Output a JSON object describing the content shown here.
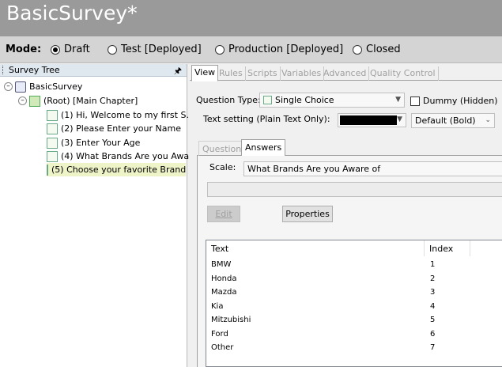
{
  "window": {
    "title": "BasicSurvey*"
  },
  "mode": {
    "label": "Mode:",
    "options": [
      {
        "label": "Draft",
        "selected": true
      },
      {
        "label": "Test [Deployed]",
        "selected": false
      },
      {
        "label": "Production [Deployed]",
        "selected": false
      },
      {
        "label": "Closed",
        "selected": false
      }
    ]
  },
  "survey_tree": {
    "title": "Survey Tree",
    "pin_icon": "pin-icon",
    "nodes": [
      {
        "label": "BasicSurvey"
      },
      {
        "label": "(Root) [Main Chapter]"
      },
      {
        "label": "(1) Hi,  Welcome to my first S..."
      },
      {
        "label": "(2) Please Enter your Name"
      },
      {
        "label": "(3) Enter Your Age"
      },
      {
        "label": "(4) What Brands Are you Awa..."
      },
      {
        "label": "(5) Choose your favorite Brand"
      }
    ]
  },
  "editor": {
    "tabs": [
      {
        "label": "View"
      },
      {
        "label": "Rules"
      },
      {
        "label": "Scripts"
      },
      {
        "label": "Variables"
      },
      {
        "label": "Advanced"
      },
      {
        "label": "Quality Control"
      }
    ],
    "question_type_label": "Question Type:",
    "question_type_value": "Single Choice",
    "dummy_label": "Dummy (Hidden)",
    "text_setting_label": "Text setting (Plain Text Only):",
    "text_style_value": "Default (Bold)",
    "text_color": "#000000",
    "inner_tabs": [
      {
        "label": "Question"
      },
      {
        "label": "Answers"
      }
    ],
    "scale_label": "Scale:",
    "scale_value": "What Brands Are you Aware of",
    "edit_button": "Edit",
    "properties_button": "Properties",
    "grid": {
      "columns": [
        "Text",
        "Index"
      ],
      "rows": [
        [
          "BMW",
          "1"
        ],
        [
          "Honda",
          "2"
        ],
        [
          "Mazda",
          "3"
        ],
        [
          "Kia",
          "4"
        ],
        [
          "Mitzubishi",
          "5"
        ],
        [
          "Ford",
          "6"
        ],
        [
          "Other",
          "7"
        ]
      ]
    }
  }
}
